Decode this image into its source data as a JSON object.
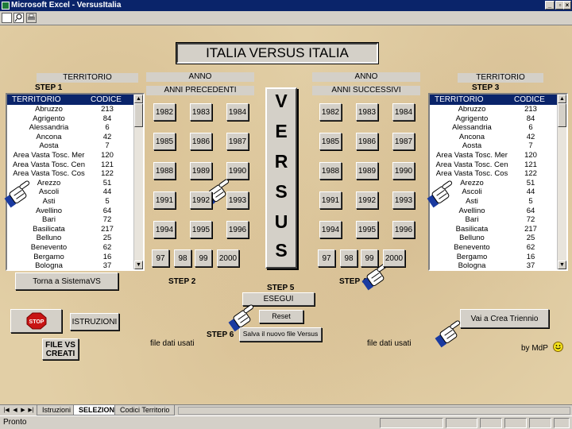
{
  "window": {
    "title": "Microsoft Excel - VersusItalia",
    "minimize": "_",
    "restore": "▫",
    "close": "×"
  },
  "main_title": "ITALIA VERSUS ITALIA",
  "left_panel": {
    "header": "TERRITORIO",
    "step": "STEP 1"
  },
  "right_panel": {
    "header": "TERRITORIO",
    "step": "STEP 3"
  },
  "list": {
    "col_name": "TERRITORIO",
    "col_code": "CODICE",
    "rows": [
      {
        "name": "Abruzzo",
        "code": "213"
      },
      {
        "name": "Agrigento",
        "code": "84"
      },
      {
        "name": "Alessandria",
        "code": "6"
      },
      {
        "name": "Ancona",
        "code": "42"
      },
      {
        "name": "Aosta",
        "code": "7"
      },
      {
        "name": "Area Vasta Tosc. Mer",
        "code": "120"
      },
      {
        "name": "Area Vasta Tosc. Cen",
        "code": "121"
      },
      {
        "name": "Area Vasta Tosc. Cos",
        "code": "122"
      },
      {
        "name": "Arezzo",
        "code": "51"
      },
      {
        "name": "Ascoli",
        "code": "44"
      },
      {
        "name": "Asti",
        "code": "5"
      },
      {
        "name": "Avellino",
        "code": "64"
      },
      {
        "name": "Bari",
        "code": "72"
      },
      {
        "name": "Basilicata",
        "code": "217"
      },
      {
        "name": "Belluno",
        "code": "25"
      },
      {
        "name": "Benevento",
        "code": "62"
      },
      {
        "name": "Bergamo",
        "code": "16"
      },
      {
        "name": "Bologna",
        "code": "37"
      }
    ]
  },
  "prev_years": {
    "header": "ANNO",
    "subheader": "ANNI PRECEDENTI",
    "step": "STEP 2",
    "rows": [
      [
        "1982",
        "1983",
        "1984"
      ],
      [
        "1985",
        "1986",
        "1987"
      ],
      [
        "1988",
        "1989",
        "1990"
      ],
      [
        "1991",
        "1992",
        "1993"
      ],
      [
        "1994",
        "1995",
        "1996"
      ]
    ],
    "last_row": [
      "97",
      "98",
      "99",
      "2000"
    ]
  },
  "next_years": {
    "header": "ANNO",
    "subheader": "ANNI SUCCESSIVI",
    "step": "STEP 4",
    "rows": [
      [
        "1982",
        "1983",
        "1984"
      ],
      [
        "1985",
        "1986",
        "1987"
      ],
      [
        "1988",
        "1989",
        "1990"
      ],
      [
        "1991",
        "1992",
        "1993"
      ],
      [
        "1994",
        "1995",
        "1996"
      ]
    ],
    "last_row": [
      "97",
      "98",
      "99",
      "2000"
    ]
  },
  "versus_letters": [
    "V",
    "E",
    "R",
    "S",
    "U",
    "S"
  ],
  "buttons": {
    "torna": "Torna a SistemaVS",
    "stop": "STOP",
    "istruzioni": "ISTRUZIONI",
    "file_vs_creati": "FILE  VS\nCREATI",
    "esegui": "ESEGUI",
    "reset": "Reset",
    "salva": "Salva il nuovo file Versus",
    "crea_triennio": "Vai a Crea Triennio"
  },
  "steps": {
    "step5": "STEP 5",
    "step6": "STEP 6"
  },
  "file_dati_left": "file dati usati",
  "file_dati_right": "file dati usati",
  "credit": "by MdP",
  "tabs": [
    "Istruzioni",
    "SELEZIONE",
    "Codici Territorio"
  ],
  "active_tab": "SELEZIONE",
  "status": "Pronto",
  "colors": {
    "selection_blue": "#0a246a",
    "sheet_bg": "#e2cfa6",
    "stop_red": "#c81414",
    "hand_blue": "#1a3aa0"
  }
}
